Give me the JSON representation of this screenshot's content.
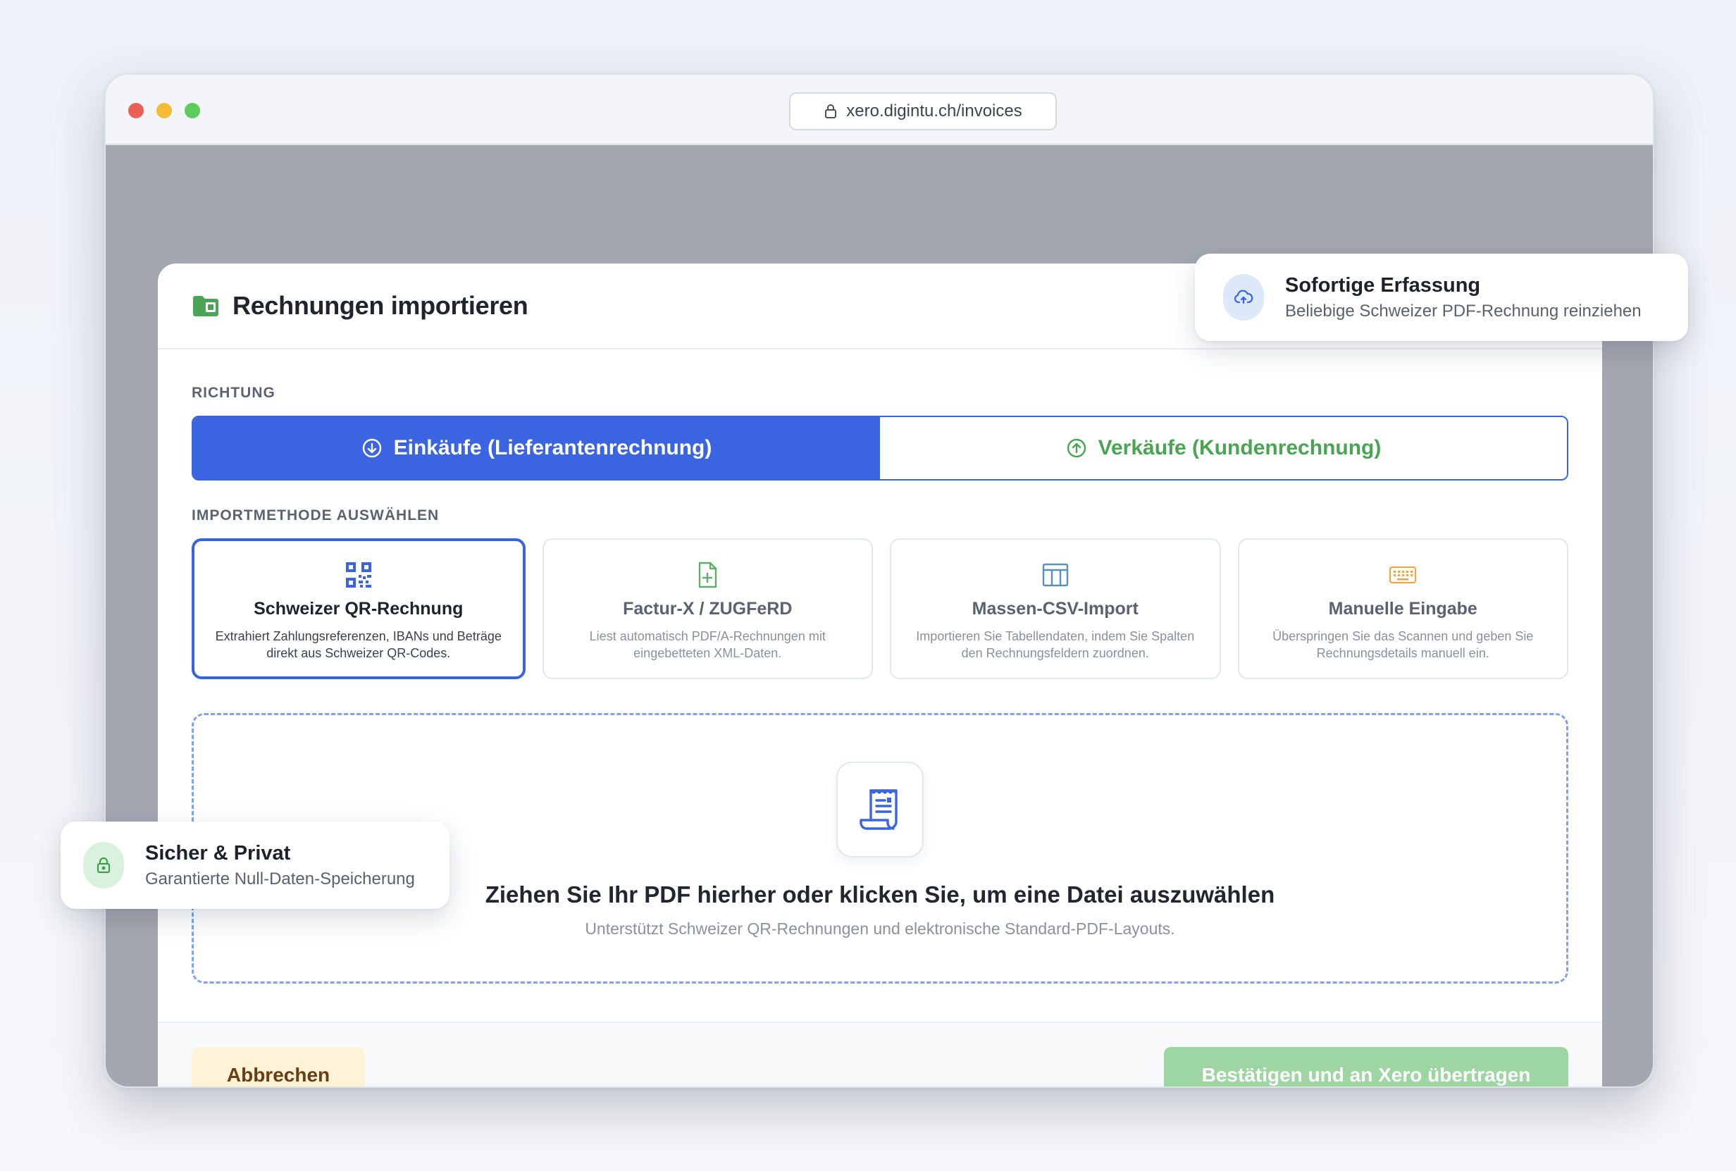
{
  "browser": {
    "url": "xero.digintu.ch/invoices"
  },
  "modal": {
    "title": "Rechnungen importieren",
    "direction_label": "RICHTUNG",
    "direction_options": [
      {
        "label": "Einkäufe (Lieferantenrechnung)",
        "icon": "arrow-down-circle-icon",
        "selected": true
      },
      {
        "label": "Verkäufe (Kundenrechnung)",
        "icon": "arrow-up-circle-icon",
        "selected": false
      }
    ],
    "method_label": "IMPORTMETHODE AUSWÄHLEN",
    "methods": [
      {
        "title": "Schweizer QR-Rechnung",
        "description": "Extrahiert Zahlungsreferenzen, IBANs und Beträge direkt aus Schweizer QR-Codes.",
        "icon": "qr-code-icon",
        "selected": true
      },
      {
        "title": "Factur-X / ZUGFeRD",
        "description": "Liest automatisch PDF/A-Rechnungen mit eingebetteten XML-Daten.",
        "icon": "file-plus-icon",
        "selected": false
      },
      {
        "title": "Massen-CSV-Import",
        "description": "Importieren Sie Tabellendaten, indem Sie Spalten den Rechnungsfeldern zuordnen.",
        "icon": "table-icon",
        "selected": false
      },
      {
        "title": "Manuelle Eingabe",
        "description": "Überspringen Sie das Scannen und geben Sie Rechnungsdetails manuell ein.",
        "icon": "keyboard-icon",
        "selected": false
      }
    ],
    "dropzone": {
      "title": "Ziehen Sie Ihr PDF hierher oder klicken Sie, um eine Datei auszuwählen",
      "subtitle": "Unterstützt Schweizer QR-Rechnungen und elektronische Standard-PDF-Layouts.",
      "icon": "receipt-icon"
    },
    "footer": {
      "cancel_label": "Abbrechen",
      "confirm_label": "Bestätigen und an Xero übertragen"
    }
  },
  "toasts": {
    "capture": {
      "title": "Sofortige Erfassung",
      "subtitle": "Beliebige Schweizer PDF-Rechnung reinziehen",
      "icon": "cloud-upload-icon"
    },
    "privacy": {
      "title": "Sicher & Privat",
      "subtitle": "Garantierte Null-Daten-Speicherung",
      "icon": "lock-icon"
    }
  },
  "colors": {
    "primary_blue": "#3b64e0",
    "sales_green": "#49a553",
    "confirm_green": "#9dd6a3",
    "cancel_bg": "#fdf3d7",
    "cancel_text": "#6a3d12"
  }
}
